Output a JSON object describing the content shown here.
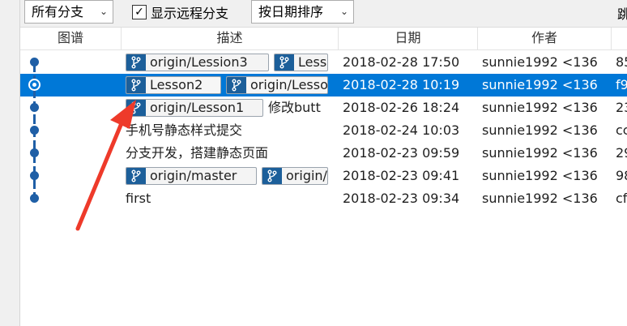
{
  "toolbar": {
    "branch_filter": "所有分支",
    "show_remote_label": "显示远程分支",
    "show_remote_checked": "✓",
    "sort_label": "按日期排序",
    "jump_label": "跳"
  },
  "columns": {
    "graph": "图谱",
    "description": "描述",
    "date": "日期",
    "author": "作者"
  },
  "rows": [
    {
      "tags": [
        "origin/Lession3",
        "Lessi"
      ],
      "description": "",
      "date": "2018-02-28 17:50",
      "author": "sunnie1992 <136",
      "hash": "85"
    },
    {
      "tags": [
        "Lesson2",
        "origin/Lesso"
      ],
      "description": "",
      "date": "2018-02-28 10:19",
      "author": "sunnie1992 <136",
      "hash": "f9",
      "selected": true
    },
    {
      "tags": [
        "origin/Lesson1"
      ],
      "description": "修改butt",
      "date": "2018-02-26 18:24",
      "author": "sunnie1992 <136",
      "hash": "23"
    },
    {
      "tags": [],
      "description": "手机号静态样式提交",
      "date": "2018-02-24 10:03",
      "author": "sunnie1992 <136",
      "hash": "cc"
    },
    {
      "tags": [],
      "description": "分支开发，搭建静态页面",
      "date": "2018-02-23 09:59",
      "author": "sunnie1992 <136",
      "hash": "29"
    },
    {
      "tags": [
        "origin/master",
        "origin/"
      ],
      "description": "",
      "date": "2018-02-23 09:41",
      "author": "sunnie1992 <136",
      "hash": "98"
    },
    {
      "tags": [],
      "description": "first",
      "date": "2018-02-23 09:34",
      "author": "sunnie1992 <136",
      "hash": "cf"
    }
  ],
  "colors": {
    "selection": "#0078d7",
    "graph_line": "#1f5fa6",
    "branch_icon_bg": "#1c5f9a",
    "annotation_arrow": "#ee3a2a"
  },
  "icons": {
    "branch": "branch-icon",
    "checkbox": "check-icon",
    "dropdown": "chevron-down-icon"
  }
}
